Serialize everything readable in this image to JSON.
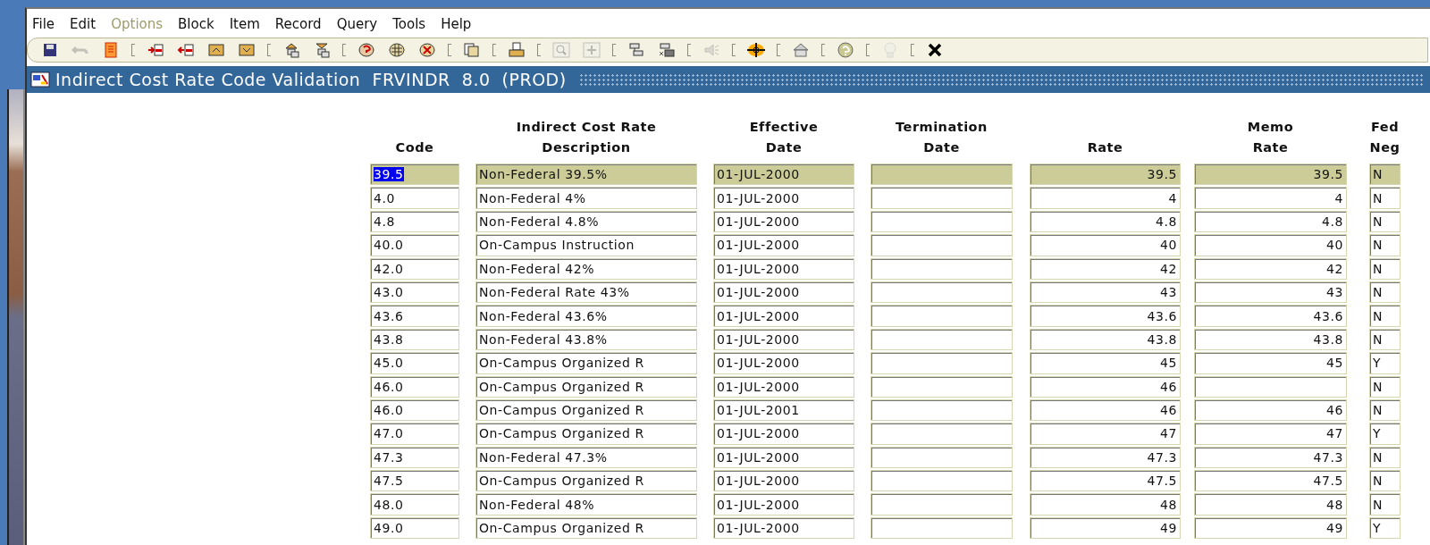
{
  "menu": [
    {
      "label": "File",
      "disabled": false
    },
    {
      "label": "Edit",
      "disabled": false
    },
    {
      "label": "Options",
      "disabled": true
    },
    {
      "label": "Block",
      "disabled": false
    },
    {
      "label": "Item",
      "disabled": false
    },
    {
      "label": "Record",
      "disabled": false
    },
    {
      "label": "Query",
      "disabled": false
    },
    {
      "label": "Tools",
      "disabled": false
    },
    {
      "label": "Help",
      "disabled": false
    }
  ],
  "toolbar": [
    {
      "disabled": false
    },
    {
      "disabled": true
    },
    {
      "disabled": false
    },
    {
      "disabled": false
    },
    {
      "disabled": false
    },
    {
      "disabled": false
    },
    {
      "disabled": false
    },
    {
      "disabled": false
    },
    {
      "disabled": false
    },
    {
      "disabled": false
    },
    {
      "disabled": false
    },
    {
      "disabled": false
    },
    {
      "disabled": false
    },
    {
      "disabled": false
    },
    {
      "disabled": true
    },
    {
      "disabled": true
    },
    {
      "disabled": false
    },
    {
      "disabled": false
    },
    {
      "disabled": true
    },
    {
      "disabled": false
    },
    {
      "disabled": false
    },
    {
      "disabled": false
    },
    {
      "disabled": true
    },
    {
      "disabled": false
    }
  ],
  "window": {
    "title": "Indirect Cost Rate Code Validation  FRVINDR  8.0  (PROD)"
  },
  "table": {
    "columns": [
      [
        "Code"
      ],
      [
        "Indirect Cost Rate",
        "Description"
      ],
      [
        "Effective",
        "Date"
      ],
      [
        "Termination",
        "Date"
      ],
      [
        "Rate"
      ],
      [
        "Memo",
        "Rate"
      ],
      [
        "Fed",
        "Neg"
      ]
    ],
    "rows": [
      {
        "selected": true,
        "code": "39.5",
        "description": "Non-Federal 39.5%",
        "effective_date": "01-JUL-2000",
        "rate": "39.5",
        "memo_rate": "39.5",
        "fed_neg": "N"
      },
      {
        "selected": false,
        "code": "4.0",
        "description": "Non-Federal 4%",
        "effective_date": "01-JUL-2000",
        "rate": "4",
        "memo_rate": "4",
        "fed_neg": "N"
      },
      {
        "selected": false,
        "code": "4.8",
        "description": "Non-Federal 4.8%",
        "effective_date": "01-JUL-2000",
        "rate": "4.8",
        "memo_rate": "4.8",
        "fed_neg": "N"
      },
      {
        "selected": false,
        "code": "40.0",
        "description": "On-Campus Instruction",
        "effective_date": "01-JUL-2000",
        "rate": "40",
        "memo_rate": "40",
        "fed_neg": "N"
      },
      {
        "selected": false,
        "code": "42.0",
        "description": "Non-Federal 42%",
        "effective_date": "01-JUL-2000",
        "rate": "42",
        "memo_rate": "42",
        "fed_neg": "N"
      },
      {
        "selected": false,
        "code": "43.0",
        "description": "Non-Federal Rate 43%",
        "effective_date": "01-JUL-2000",
        "rate": "43",
        "memo_rate": "43",
        "fed_neg": "N"
      },
      {
        "selected": false,
        "code": "43.6",
        "description": "Non-Federal 43.6%",
        "effective_date": "01-JUL-2000",
        "rate": "43.6",
        "memo_rate": "43.6",
        "fed_neg": "N"
      },
      {
        "selected": false,
        "code": "43.8",
        "description": "Non-Federal 43.8%",
        "effective_date": "01-JUL-2000",
        "rate": "43.8",
        "memo_rate": "43.8",
        "fed_neg": "N"
      },
      {
        "selected": false,
        "code": "45.0",
        "description": "On-Campus Organized R",
        "effective_date": "01-JUL-2000",
        "rate": "45",
        "memo_rate": "45",
        "fed_neg": "Y"
      },
      {
        "selected": false,
        "code": "46.0",
        "description": "On-Campus Organized R",
        "effective_date": "01-JUL-2000",
        "rate": "46",
        "fed_neg": "N"
      },
      {
        "selected": false,
        "code": "46.0",
        "description": "On-Campus Organized R",
        "effective_date": "01-JUL-2001",
        "rate": "46",
        "memo_rate": "46",
        "fed_neg": "N"
      },
      {
        "selected": false,
        "code": "47.0",
        "description": "On-Campus Organized R",
        "effective_date": "01-JUL-2000",
        "rate": "47",
        "memo_rate": "47",
        "fed_neg": "Y"
      },
      {
        "selected": false,
        "code": "47.3",
        "description": "Non-Federal 47.3%",
        "effective_date": "01-JUL-2000",
        "rate": "47.3",
        "memo_rate": "47.3",
        "fed_neg": "N"
      },
      {
        "selected": false,
        "code": "47.5",
        "description": "On-Campus Organized R",
        "effective_date": "01-JUL-2000",
        "rate": "47.5",
        "memo_rate": "47.5",
        "fed_neg": "N"
      },
      {
        "selected": false,
        "code": "48.0",
        "description": "Non-Federal 48%",
        "effective_date": "01-JUL-2000",
        "rate": "48",
        "memo_rate": "48",
        "fed_neg": "N"
      },
      {
        "selected": false,
        "code": "49.0",
        "description": "On-Campus Organized R",
        "effective_date": "01-JUL-2000",
        "rate": "49",
        "memo_rate": "49",
        "fed_neg": "Y"
      }
    ]
  }
}
